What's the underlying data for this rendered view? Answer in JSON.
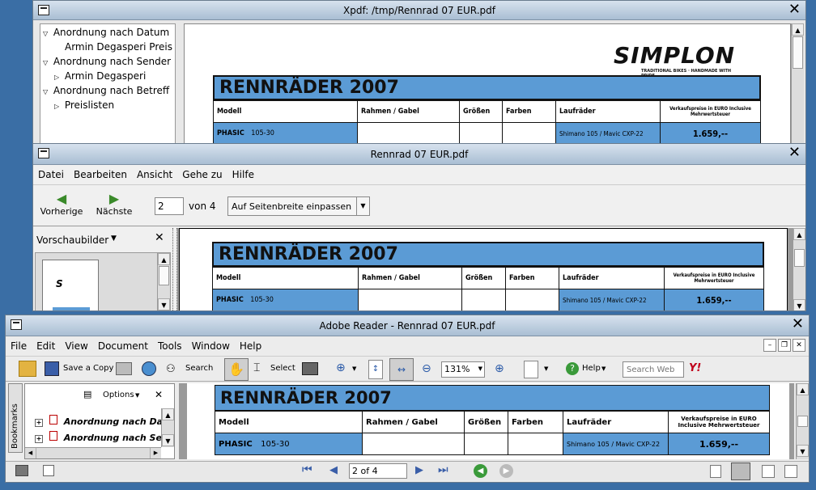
{
  "xpdf": {
    "title": "Xpdf: /tmp/Rennrad 07 EUR.pdf",
    "outline": [
      {
        "label": "Anordnung nach Datum",
        "level": 0,
        "expander": "▽"
      },
      {
        "label": "Armin Degasperi     Preis",
        "level": 1,
        "expander": ""
      },
      {
        "label": "Anordnung nach Sender",
        "level": 0,
        "expander": "▽"
      },
      {
        "label": "Armin Degasperi",
        "level": 1,
        "expander": "▷"
      },
      {
        "label": "Anordnung nach Betreff",
        "level": 0,
        "expander": "▽"
      },
      {
        "label": "Preislisten",
        "level": 1,
        "expander": "▷"
      }
    ]
  },
  "evince": {
    "title": "Rennrad 07 EUR.pdf",
    "menu": [
      "Datei",
      "Bearbeiten",
      "Ansicht",
      "Gehe zu",
      "Hilfe"
    ],
    "prev_label": "Vorherige",
    "next_label": "Nächste",
    "page_value": "2",
    "page_of": "von 4",
    "zoom_label": "Auf Seitenbreite einpassen",
    "sidebar_label": "Vorschaubilder"
  },
  "acrobat": {
    "title": "Adobe Reader - Rennrad 07 EUR.pdf",
    "menu": [
      "File",
      "Edit",
      "View",
      "Document",
      "Tools",
      "Window",
      "Help"
    ],
    "save_copy_label": "Save a Copy",
    "search_label": "Search",
    "select_label": "Select",
    "zoom_value": "131%",
    "help_label": "Help",
    "search_web_placeholder": "Search Web",
    "yahoo_label": "Y!",
    "options_label": "Options",
    "bookmarks_tab": "Bookmarks",
    "bookmarks": [
      "Anordnung nach Da",
      "Anordnung nach Se"
    ],
    "page_indicator": "2 of 4"
  },
  "pdf": {
    "logo": "SIMPLON",
    "logo_tagline": "TRADITIONAL BIKES · HANDMADE WITH PRIDE",
    "heading": "RENNRÄDER 2007",
    "columns": [
      "Modell",
      "Rahmen  / Gabel",
      "Größen",
      "Farben",
      "Laufräder",
      "Verkaufspreise in EURO Inclusive Mehrwertsteuer"
    ],
    "row_model": "PHASIC",
    "row_number": "105-30",
    "row_wheels": "Shimano 105 / Mavic CXP-22",
    "row_price": "1.659,--"
  },
  "colors": {
    "table_blue": "#5b9bd5",
    "titlebar": "#b9cadb",
    "desktop": "#3a6ea5"
  }
}
